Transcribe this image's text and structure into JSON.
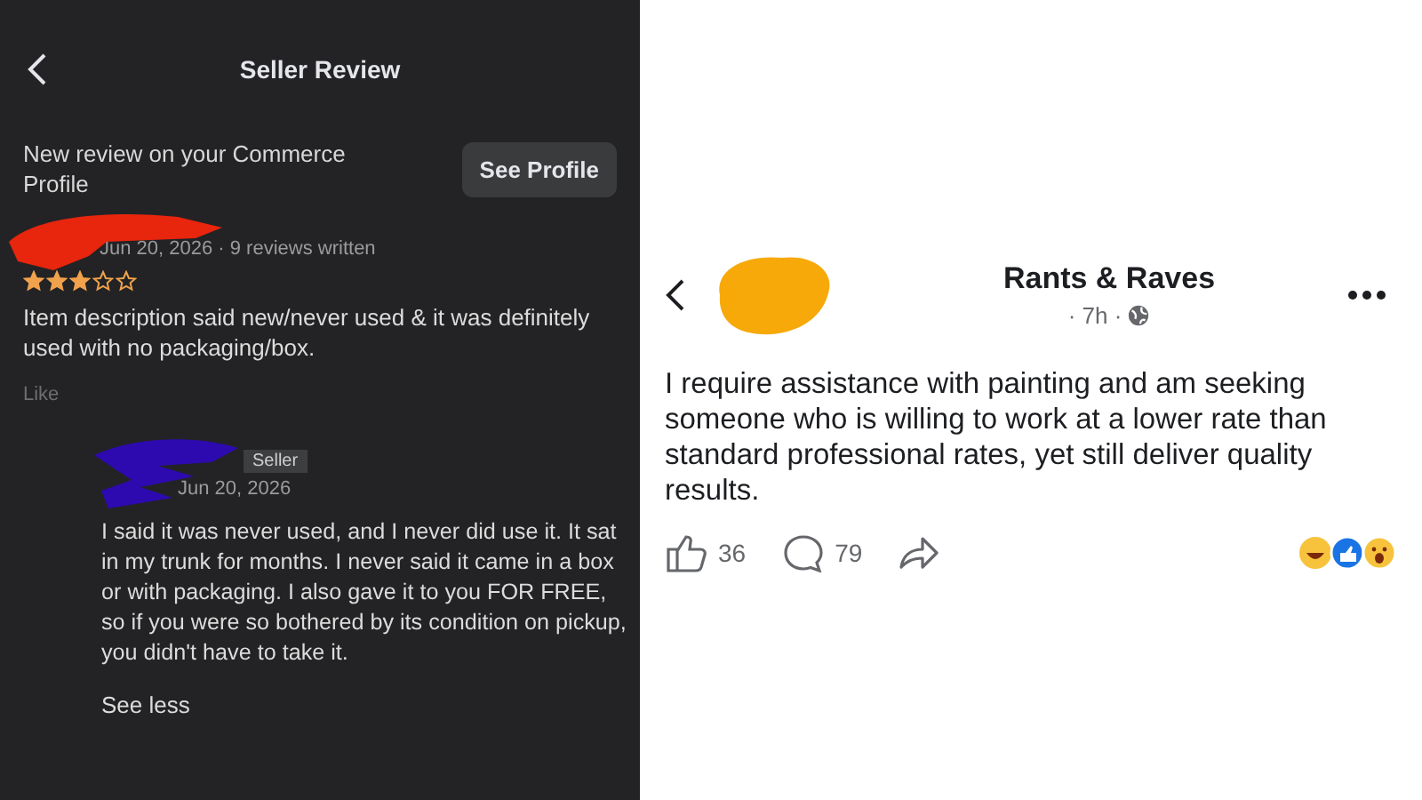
{
  "seller_review": {
    "title": "Seller Review",
    "notice": "New review on your Commerce Profile",
    "see_profile": "See Profile",
    "review": {
      "meta": "Jun 20, 2026 · 9 reviews written",
      "stars": 3,
      "text": "Item description said new/never used & it was definitely used with no packaging/box.",
      "like": "Like"
    },
    "reply": {
      "badge": "Seller",
      "date": "Jun 20, 2026",
      "text": "I said it was never used, and I never did use it. It sat in my trunk for months. I never said it came in a box or with packaging. I also gave it to you FOR FREE, so if you were so bothered by its condition on pickup, you didn't have to take it.",
      "see_less": "See less"
    }
  },
  "post": {
    "group": "Rants & Raves",
    "time": "· 7h ·",
    "text": "I require assistance with painting and am seeking someone who is willing to work at a lower rate than standard professional rates, yet still deliver quality results.",
    "likes": "36",
    "comments": "79"
  }
}
